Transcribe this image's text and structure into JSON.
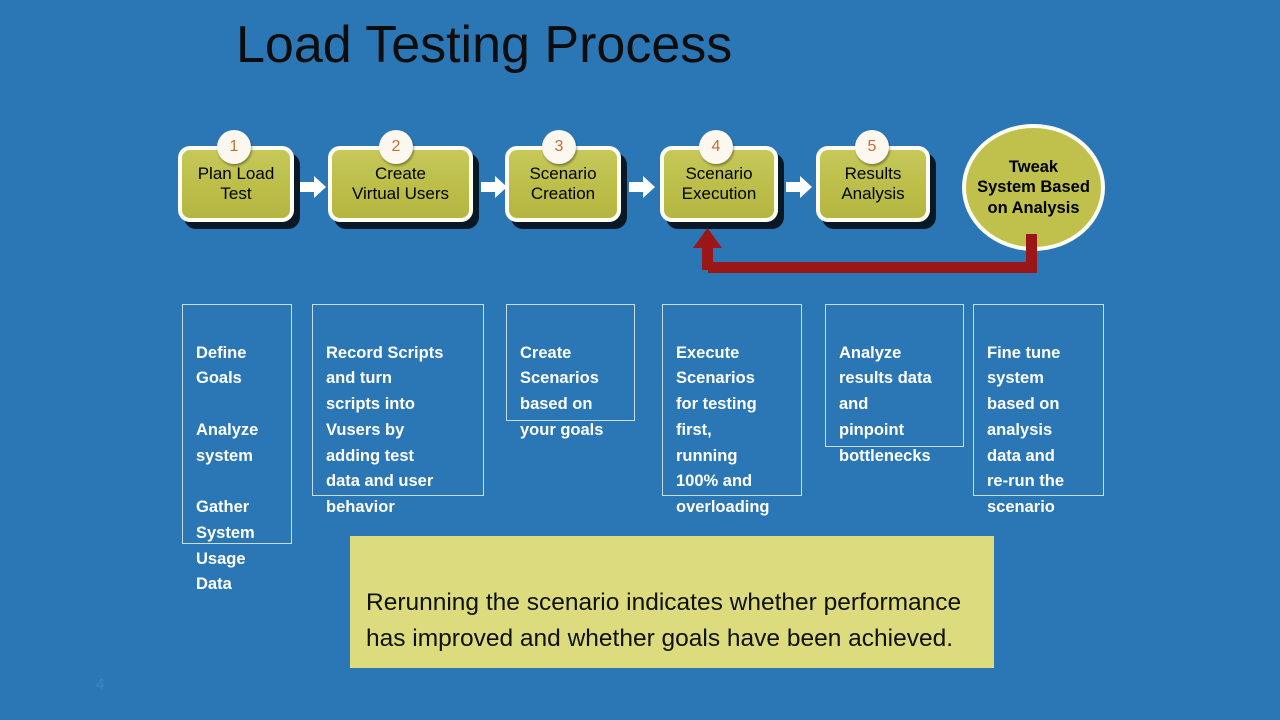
{
  "slide": {
    "title": "Load Testing Process",
    "page_number": "4",
    "background_color": "#2b77b5",
    "accent_color": "#bfc14c",
    "feedback_arrow_color": "#9b1616",
    "callout_color": "#dcdc7e"
  },
  "process_steps": [
    {
      "number": "1",
      "label": "Plan Load\nTest"
    },
    {
      "number": "2",
      "label": "Create\nVirtual Users"
    },
    {
      "number": "3",
      "label": "Scenario\nCreation"
    },
    {
      "number": "4",
      "label": "Scenario\nExecution"
    },
    {
      "number": "5",
      "label": "Results\nAnalysis"
    }
  ],
  "final_step": {
    "label": "Tweak\nSystem Based\non Analysis"
  },
  "descriptions": [
    {
      "text": "Define\nGoals\n\nAnalyze\nsystem\n\nGather\nSystem\nUsage\nData"
    },
    {
      "text": "Record Scripts\nand turn\nscripts into\nVusers by\nadding test\ndata and user\nbehavior"
    },
    {
      "text": "Create\nScenarios\nbased on\nyour goals"
    },
    {
      "text": "Execute\nScenarios\nfor testing\nfirst,\nrunning\n100% and\noverloading"
    },
    {
      "text": "Analyze\nresults data\nand\npinpoint\nbottlenecks"
    },
    {
      "text": "Fine tune\nsystem\nbased on\nanalysis\ndata and\nre-run the\nscenario"
    }
  ],
  "callout": {
    "text": "Rerunning the scenario indicates whether performance has improved and whether goals have been achieved."
  }
}
